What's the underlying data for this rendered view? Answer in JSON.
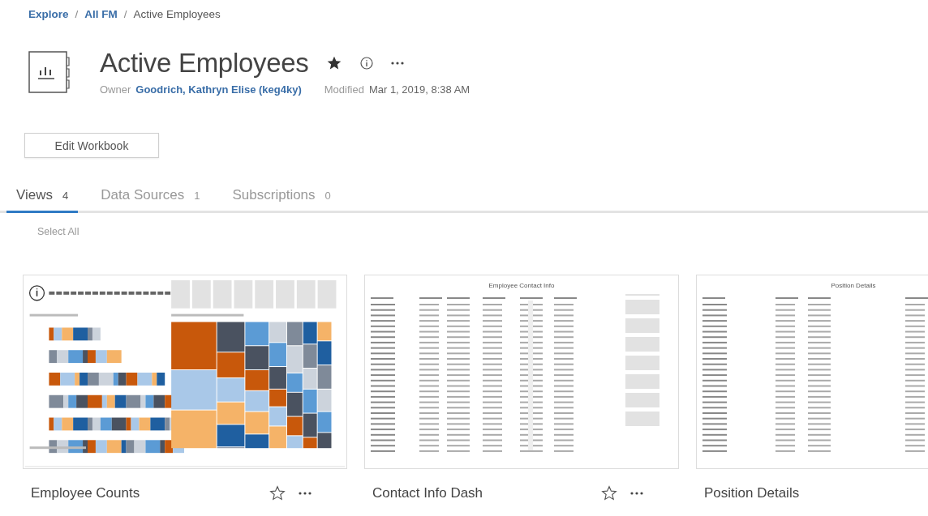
{
  "breadcrumb": {
    "separator": "/",
    "items": [
      {
        "label": "Explore",
        "link": true
      },
      {
        "label": "All FM",
        "link": true
      },
      {
        "label": "Active Employees",
        "link": false
      }
    ]
  },
  "workbook": {
    "title": "Active Employees",
    "starred": true,
    "owner_label": "Owner",
    "owner": "Goodrich, Kathryn Elise (keg4ky)",
    "modified_label": "Modified",
    "modified": "Mar 1, 2019, 8:38 AM"
  },
  "edit_button": "Edit Workbook",
  "tabs": [
    {
      "label": "Views",
      "count": "4",
      "selected": true
    },
    {
      "label": "Data Sources",
      "count": "1",
      "selected": false
    },
    {
      "label": "Subscriptions",
      "count": "0",
      "selected": false
    }
  ],
  "select_all": "Select All",
  "views": [
    {
      "name": "Employee Counts",
      "kind": "dashboard",
      "favorite": false
    },
    {
      "name": "Contact Info Dash",
      "kind": "table",
      "thumbnail_title": "Employee Contact Info",
      "filters": true,
      "favorite": false
    },
    {
      "name": "Position Details",
      "kind": "table",
      "thumbnail_title": "Position Details",
      "filters": false
    }
  ]
}
